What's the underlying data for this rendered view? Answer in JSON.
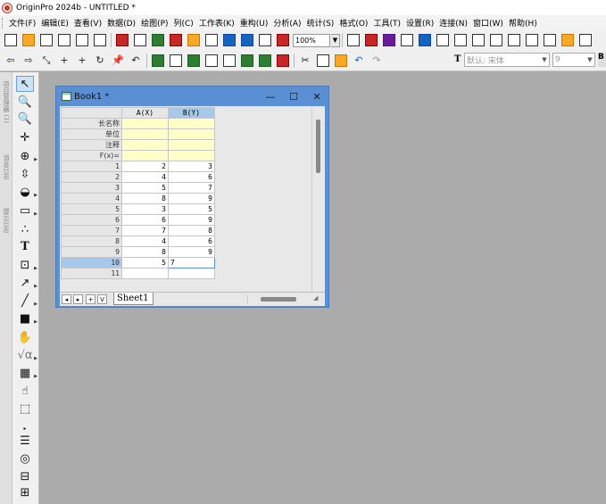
{
  "app": {
    "title": "OriginPro 2024b - UNTITLED *"
  },
  "menu": [
    "文件(F)",
    "编辑(E)",
    "查看(V)",
    "数据(D)",
    "绘图(P)",
    "列(C)",
    "工作表(K)",
    "重构(U)",
    "分析(A)",
    "统计(S)",
    "格式(O)",
    "工具(T)",
    "设置(R)",
    "连接(N)",
    "窗口(W)",
    "帮助(H)"
  ],
  "toolbar": {
    "zoom": "100%",
    "font": "默认: 宋体",
    "font_size": "9",
    "font_icon": "T"
  },
  "side_tabs": [
    "项目管理器 (1)",
    "消息日志",
    "提示日志"
  ],
  "book": {
    "title": "Book1 *",
    "min_label": "—",
    "max_label": "☐",
    "close_label": "✕",
    "columns": [
      "A(X)",
      "B(Y)"
    ],
    "meta_rows": [
      "长名称",
      "单位",
      "注释",
      "F(x)="
    ],
    "rows": [
      {
        "n": "1",
        "a": "2",
        "b": "3"
      },
      {
        "n": "2",
        "a": "4",
        "b": "6"
      },
      {
        "n": "3",
        "a": "5",
        "b": "7"
      },
      {
        "n": "4",
        "a": "8",
        "b": "9"
      },
      {
        "n": "5",
        "a": "3",
        "b": "5"
      },
      {
        "n": "6",
        "a": "6",
        "b": "9"
      },
      {
        "n": "7",
        "a": "7",
        "b": "8"
      },
      {
        "n": "8",
        "a": "4",
        "b": "6"
      },
      {
        "n": "9",
        "a": "8",
        "b": "9"
      },
      {
        "n": "10",
        "a": "5",
        "b": "7"
      },
      {
        "n": "11",
        "a": "",
        "b": ""
      }
    ],
    "sheet_tab": "Sheet1",
    "nav": [
      "◂",
      "▸",
      "+",
      "V"
    ]
  }
}
